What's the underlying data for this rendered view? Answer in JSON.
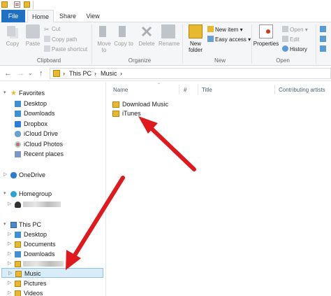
{
  "ribbon_tabs": {
    "file": "File",
    "home": "Home",
    "share": "Share",
    "view": "View"
  },
  "ribbon": {
    "clipboard": {
      "copy": "Copy",
      "paste": "Paste",
      "cut": "Cut",
      "copy_path": "Copy path",
      "paste_shortcut": "Paste shortcut",
      "label": "Clipboard"
    },
    "organize": {
      "move_to": "Move to",
      "copy_to": "Copy to",
      "delete": "Delete",
      "rename": "Rename",
      "label": "Organize",
      "to": "to"
    },
    "new": {
      "new_folder_line1": "New",
      "new_folder_line2": "folder",
      "new_item": "New item ▾",
      "easy_access": "Easy access ▾",
      "label": "New"
    },
    "open": {
      "properties": "Properties",
      "open": "Open ▾",
      "edit": "Edit",
      "history": "History",
      "label": "Open"
    }
  },
  "address": {
    "back": "←",
    "forward": "→",
    "history": "⌄",
    "up": "↑",
    "crumbs": [
      "›",
      "This PC",
      "›",
      "Music",
      "›"
    ]
  },
  "nav": {
    "favorites": "Favorites",
    "desktop": "Desktop",
    "downloads": "Downloads",
    "dropbox": "Dropbox",
    "icloud_drive": "iCloud Drive",
    "icloud_photos": "iCloud Photos",
    "recent_places": "Recent places",
    "onedrive": "OneDrive",
    "homegroup": "Homegroup",
    "this_pc": "This PC",
    "pc_desktop": "Desktop",
    "pc_documents": "Documents",
    "pc_downloads": "Downloads",
    "pc_music": "Music",
    "pc_pictures": "Pictures",
    "pc_videos": "Videos"
  },
  "columns": {
    "name": "Name",
    "number": "#",
    "title": "Title",
    "artists": "Contributing artists"
  },
  "files": [
    {
      "name": "Download Music"
    },
    {
      "name": "iTunes"
    }
  ],
  "colors": {
    "accent": "#1f6fc2",
    "folder": "#e8b92f",
    "selection": "#d8ecfa",
    "arrow": "#e0191e"
  },
  "icons": [
    "copy-icon",
    "paste-icon",
    "cut-icon",
    "move-to-icon",
    "copy-to-icon",
    "delete-icon",
    "rename-icon",
    "new-folder-icon",
    "properties-icon",
    "folder-icon",
    "star-icon",
    "arrow-annotation"
  ]
}
